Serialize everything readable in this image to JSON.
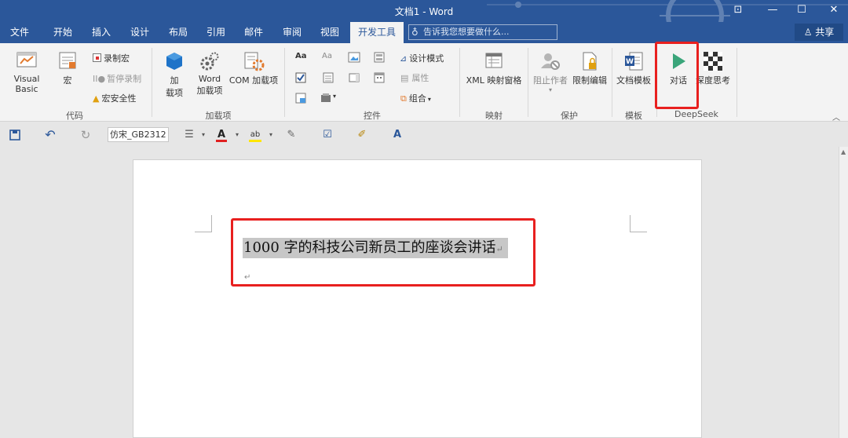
{
  "window": {
    "title": "文档1 - Word",
    "controls": [
      "⊡",
      "—",
      "☐",
      "✕"
    ]
  },
  "tabs": {
    "items": [
      "文件",
      "开始",
      "插入",
      "设计",
      "布局",
      "引用",
      "邮件",
      "审阅",
      "视图",
      "开发工具"
    ],
    "active": "开发工具",
    "tell_me_placeholder": "告诉我您想要做什么...",
    "share_label": "共享"
  },
  "ribbon": {
    "code": {
      "label": "代码",
      "visual_basic": "Visual Basic",
      "macros": "宏",
      "record_macro": "录制宏",
      "pause_recording": "暂停录制",
      "macro_security": "宏安全性"
    },
    "addins": {
      "label": "加载项",
      "addins_line1": "加",
      "addins_line2": "载项",
      "word_addins_line1": "Word",
      "word_addins_line2": "加载项",
      "com_addins": "COM 加载项"
    },
    "controls": {
      "label": "控件",
      "design_mode": "设计模式",
      "properties": "属性",
      "group": "组合"
    },
    "mapping": {
      "label": "映射",
      "xml_mapping_pane": "XML 映射窗格"
    },
    "protect": {
      "label": "保护",
      "block_authors": "阻止作者",
      "restrict_editing": "限制编辑"
    },
    "templates": {
      "label": "模板",
      "document_template": "文档模板"
    },
    "deepseek": {
      "label": "DeepSeek",
      "chat": "对话",
      "deep_think": "深度思考"
    }
  },
  "quick_access": {
    "font_name": "仿宋_GB2312"
  },
  "document": {
    "line1": "1000 字的科技公司新员工的座谈会讲话",
    "para_mark": "↵"
  },
  "colors": {
    "word_blue": "#2b579a",
    "highlight_red": "#e8201f",
    "selection_gray": "#c7c7c7"
  }
}
